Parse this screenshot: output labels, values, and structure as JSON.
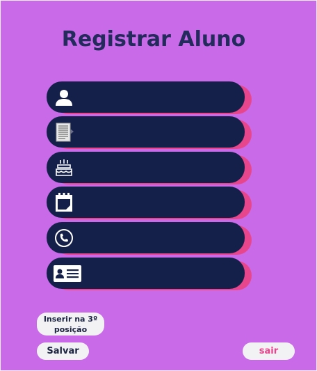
{
  "title": "Registrar Aluno",
  "fields": [
    {
      "icon": "user-icon"
    },
    {
      "icon": "document-icon"
    },
    {
      "icon": "birthday-cake-icon"
    },
    {
      "icon": "calendar-icon"
    },
    {
      "icon": "phone-icon"
    },
    {
      "icon": "id-card-icon"
    }
  ],
  "buttons": {
    "insert_label": "Inserir na 3º posição",
    "save_label": "Salvar",
    "exit_label": "sair"
  },
  "colors": {
    "background": "#c96ae8",
    "field": "#14204a",
    "field_accent": "#e8468c",
    "title": "#232a5c",
    "button": "#f2f2f4",
    "exit_text": "#e8468c"
  }
}
